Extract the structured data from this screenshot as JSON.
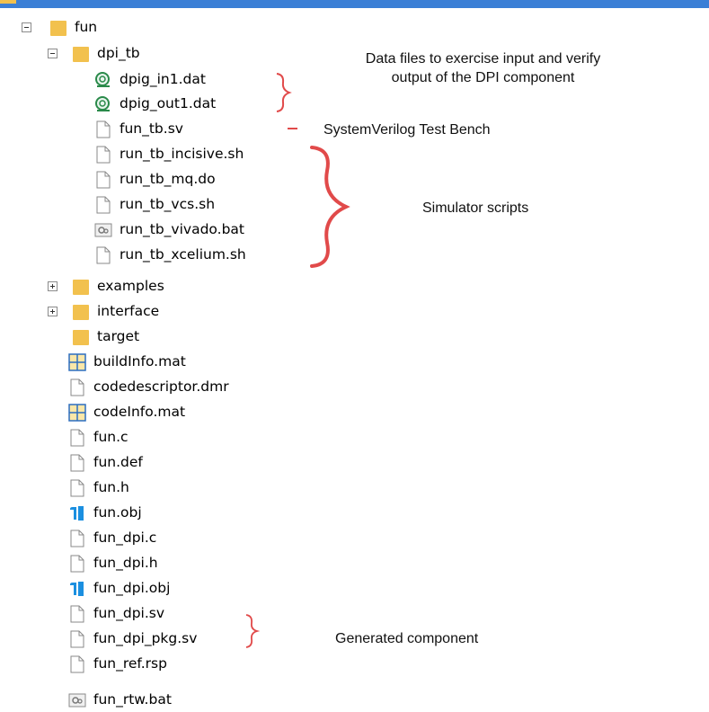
{
  "tree": {
    "root": "fun",
    "dpi_tb": {
      "label": "dpi_tb",
      "items": [
        "dpig_in1.dat",
        "dpig_out1.dat",
        "fun_tb.sv",
        "run_tb_incisive.sh",
        "run_tb_mq.do",
        "run_tb_vcs.sh",
        "run_tb_vivado.bat",
        "run_tb_xcelium.sh"
      ]
    },
    "folders": [
      "examples",
      "interface",
      "target"
    ],
    "files": [
      "buildInfo.mat",
      "codedescriptor.dmr",
      "codeInfo.mat",
      "fun.c",
      "fun.def",
      "fun.h",
      "fun.obj",
      "fun_dpi.c",
      "fun_dpi.h",
      "fun_dpi.obj",
      "fun_dpi.sv",
      "fun_dpi_pkg.sv",
      "fun_ref.rsp",
      "fun_rtw.bat"
    ]
  },
  "annotations": {
    "data_files_line1": "Data files to exercise input and verify",
    "data_files_line2": "output of the DPI component",
    "test_bench": "SystemVerilog Test Bench",
    "simulator_scripts": "Simulator scripts",
    "generated_component": "Generated component"
  },
  "colors": {
    "folder": "#f2c14e",
    "brace": "#e14a4a",
    "titlebar": "#3b7fd6",
    "obj_icon": "#1b8fe0",
    "mat_grid": "#2d6fc0"
  }
}
